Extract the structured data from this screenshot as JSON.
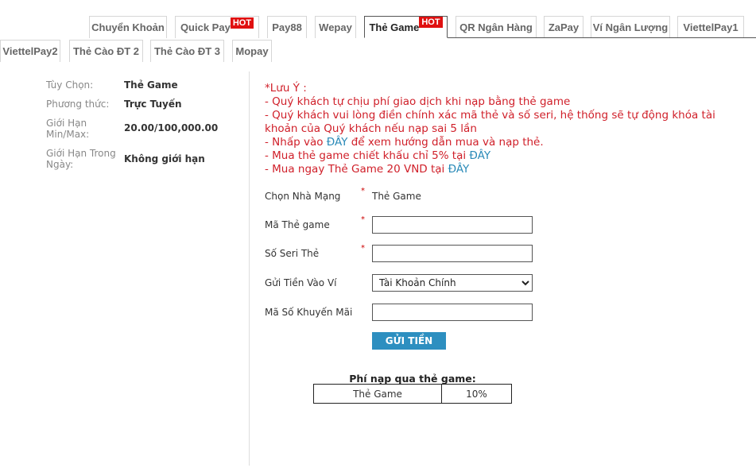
{
  "tabs_row1": [
    {
      "label": "Chuyển Khoản"
    },
    {
      "label": "Quick Pay",
      "badge": "HOT"
    },
    {
      "label": "Pay88"
    },
    {
      "label": "Wepay"
    },
    {
      "label": "Thẻ Game",
      "badge": "HOT",
      "active": true
    },
    {
      "label": "QR Ngân Hàng"
    },
    {
      "label": "ZaPay"
    },
    {
      "label": "Ví Ngân Lượng"
    },
    {
      "label": "ViettelPay1"
    }
  ],
  "tabs_row2": [
    {
      "label": "ViettelPay2"
    },
    {
      "label": "Thẻ Cào ĐT 2"
    },
    {
      "label": "Thẻ Cào ĐT 3"
    },
    {
      "label": "Mopay"
    }
  ],
  "info": [
    {
      "key": "Tùy Chọn:",
      "value": "Thẻ Game"
    },
    {
      "key": "Phương thức:",
      "value": "Trực Tuyến"
    },
    {
      "key": "Giới Hạn Min/Max:",
      "value": "20.00/100,000.00"
    },
    {
      "key": "Giới Hạn Trong Ngày:",
      "value": "Không giới hạn"
    }
  ],
  "notes": {
    "title": "*Lưu Ý :",
    "l1": "- Quý khách tự chịu phí giao dịch khi nạp bằng thẻ game",
    "l2": "- Quý khách vui lòng điền chính xác mã thẻ và số seri, hệ thống sẽ tự động khóa tài khoản của Quý khách nếu nạp sai 5 lần",
    "l3a": "- Nhấp vào ",
    "l3link": "ĐÂY",
    "l3b": " để xem hướng dẫn mua và nạp thẻ.",
    "l4a": "- Mua thẻ game chiết khấu chỉ 5% tại ",
    "l4link": "ĐÂY",
    "l5a": "- Mua ngay Thẻ Game 20 VND tại ",
    "l5link": "ĐÂY"
  },
  "form": {
    "network_label": "Chọn Nhà Mạng",
    "network_value": "Thẻ Game",
    "code_label": "Mã Thẻ game",
    "code_value": "",
    "serial_label": "Số Seri Thẻ",
    "serial_value": "",
    "wallet_label": "Gửi Tiền Vào Ví",
    "wallet_value": "Tài Khoản Chính",
    "promo_label": "Mã Số Khuyến Mãi",
    "promo_value": "",
    "required": "*",
    "submit": "GỬI TIỀN"
  },
  "fees": {
    "title": "Phí nạp qua thẻ game:",
    "rows": [
      {
        "type": "Thẻ Game",
        "fee": "10%"
      }
    ]
  }
}
